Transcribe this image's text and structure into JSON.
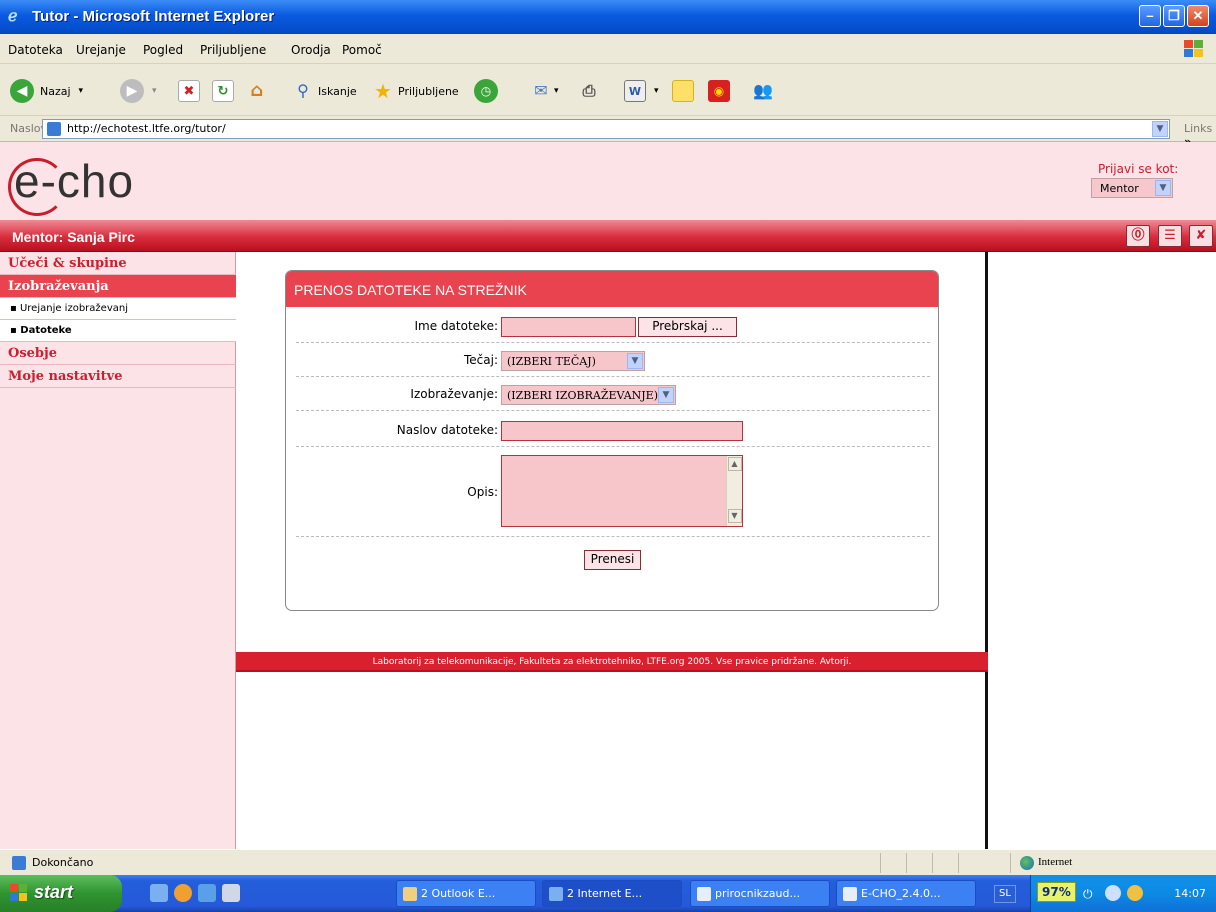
{
  "window": {
    "title": "Tutor - Microsoft Internet Explorer"
  },
  "menu": {
    "items": [
      "Datoteka",
      "Urejanje",
      "Pogled",
      "Priljubljene",
      "Orodja",
      "Pomoč"
    ]
  },
  "toolbar": {
    "back_label": "Nazaj",
    "search_label": "Iskanje",
    "favorites_label": "Priljubljene"
  },
  "address": {
    "label": "Naslov",
    "url": "http://echotest.ltfe.org/tutor/",
    "links_label": "Links"
  },
  "site": {
    "logo": "e-cho",
    "login_as_label": "Prijavi se kot:",
    "login_as_value": "Mentor",
    "user_label": "Mentor: Sanja Pirc"
  },
  "sidebar": {
    "items": [
      {
        "label": "Učeči & skupine"
      },
      {
        "label": "Izobraževanja"
      },
      {
        "label": "Urejanje izobraževanj"
      },
      {
        "label": "Datoteke"
      },
      {
        "label": "Osebje"
      },
      {
        "label": "Moje nastavitve"
      }
    ]
  },
  "form": {
    "title": "PRENOS DATOTEKE NA STREŽNIK",
    "file_label": "Ime datoteke:",
    "browse_label": "Prebrskaj ...",
    "course_label": "Tečaj:",
    "course_value": "(IZBERI TEČAJ)",
    "training_label": "Izobraževanje:",
    "training_value": "(IZBERI IZOBRAŽEVANJE)",
    "file_title_label": "Naslov datoteke:",
    "description_label": "Opis:",
    "submit_label": "Prenesi"
  },
  "footer": {
    "text": "Laboratorij za telekomunikacije, Fakulteta za elektrotehniko, LTFE.org 2005. Vse pravice pridržane. Avtorji."
  },
  "statusbar": {
    "status": "Dokončano",
    "zone": "Internet"
  },
  "taskbar": {
    "start_label": "start",
    "tasks": [
      {
        "label": "2 Outlook E..."
      },
      {
        "label": "2 Internet E..."
      },
      {
        "label": "prirocnikzaud..."
      },
      {
        "label": "E-CHO_2.4.0..."
      }
    ],
    "lang": "SL",
    "battery": "97%",
    "clock": "14:07"
  },
  "colors": {
    "accent": "#e8434f",
    "page_bg": "#fbe3e7",
    "xp_blue": "#245edb"
  }
}
